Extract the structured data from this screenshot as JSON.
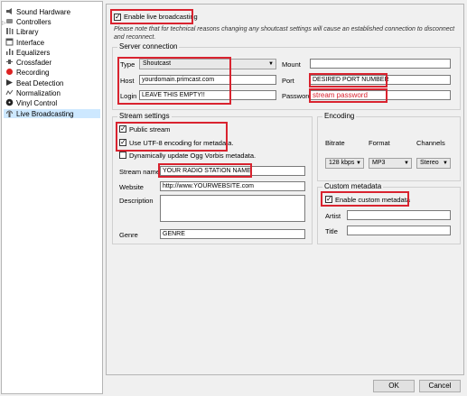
{
  "sidebar": {
    "items": [
      {
        "label": "Sound Hardware",
        "icon": "speaker-icon"
      },
      {
        "label": "Controllers",
        "icon": "controller-icon"
      },
      {
        "label": "Library",
        "icon": "library-icon"
      },
      {
        "label": "Interface",
        "icon": "interface-icon"
      },
      {
        "label": "Equalizers",
        "icon": "equalizer-icon"
      },
      {
        "label": "Crossfader",
        "icon": "crossfader-icon"
      },
      {
        "label": "Recording",
        "icon": "recording-icon"
      },
      {
        "label": "Beat Detection",
        "icon": "beat-icon"
      },
      {
        "label": "Normalization",
        "icon": "normalization-icon"
      },
      {
        "label": "Vinyl Control",
        "icon": "vinyl-icon"
      },
      {
        "label": "Live Broadcasting",
        "icon": "broadcast-icon"
      }
    ]
  },
  "main": {
    "enable_live": "Enable live broadcasting",
    "note": "Please note that for technical reasons changing any shoutcast settings will cause an established connection to disconnect and reconnect."
  },
  "server": {
    "title": "Server connection",
    "type_label": "Type",
    "type_value": "Shoutcast",
    "host_label": "Host",
    "host_value": "yourdomain.primcast.com",
    "login_label": "Login",
    "login_value": "LEAVE THIS EMPTY!!",
    "mount_label": "Mount",
    "mount_value": "",
    "port_label": "Port",
    "port_value": "DESIRED PORT NUMBER",
    "password_label": "Password",
    "password_value": "stream password"
  },
  "stream": {
    "title": "Stream settings",
    "public": "Public stream",
    "utf8": "Use UTF-8 encoding for metadata.",
    "ogg": "Dynamically update Ogg Vorbis metadata.",
    "name_label": "Stream name",
    "name_value": "YOUR RADIO STATION NAME",
    "website_label": "Website",
    "website_value": "http://www.YOURWEBSITE.com",
    "description_label": "Description",
    "genre_label": "Genre",
    "genre_value": "GENRE"
  },
  "encoding": {
    "title": "Encoding",
    "bitrate_label": "Bitrate",
    "format_label": "Format",
    "channels_label": "Channels",
    "bitrate_value": "128 kbps",
    "format_value": "MP3",
    "channels_value": "Stereo"
  },
  "custom": {
    "title": "Custom metadata",
    "enable": "Enable custom metadata",
    "artist_label": "Artist",
    "title_label": "Title"
  },
  "buttons": {
    "ok": "OK",
    "cancel": "Cancel"
  },
  "colors": {
    "highlight": "#d9232f",
    "selection": "#cde8ff",
    "password_text": "#d9232f"
  }
}
